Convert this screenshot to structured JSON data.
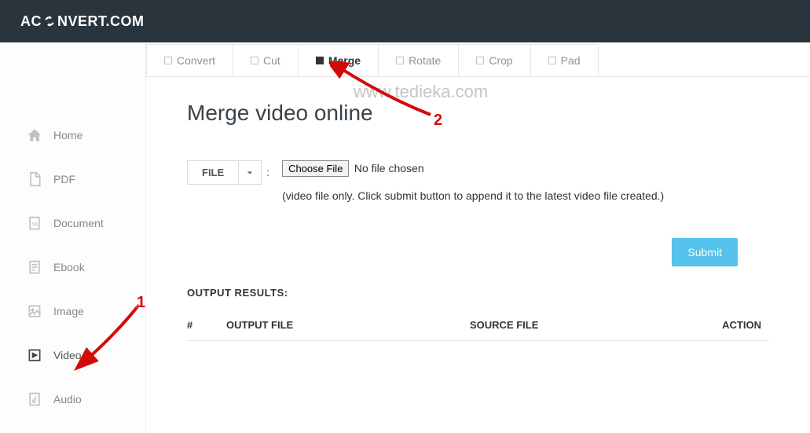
{
  "brand": {
    "left": "AC",
    "right": "NVERT.COM"
  },
  "sidebar": {
    "items": [
      {
        "label": "Home"
      },
      {
        "label": "PDF"
      },
      {
        "label": "Document"
      },
      {
        "label": "Ebook"
      },
      {
        "label": "Image"
      },
      {
        "label": "Video"
      },
      {
        "label": "Audio"
      }
    ]
  },
  "tabs": [
    {
      "label": "Convert"
    },
    {
      "label": "Cut"
    },
    {
      "label": "Merge",
      "active": true
    },
    {
      "label": "Rotate"
    },
    {
      "label": "Crop"
    },
    {
      "label": "Pad"
    }
  ],
  "page": {
    "title": "Merge video online",
    "file_button": "FILE",
    "choose_file": "Choose File",
    "no_file": "No file chosen",
    "hint": "(video file only. Click submit button to append it to the latest video file created.)",
    "submit": "Submit"
  },
  "results": {
    "heading": "OUTPUT RESULTS:",
    "columns": {
      "num": "#",
      "output": "OUTPUT FILE",
      "source": "SOURCE FILE",
      "action": "ACTION"
    }
  },
  "watermark": "www.tedieka.com",
  "annotations": {
    "one": "1",
    "two": "2"
  }
}
